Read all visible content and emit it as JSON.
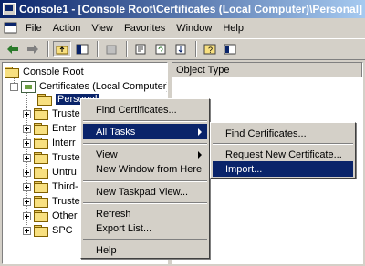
{
  "window": {
    "title": "Console1 - [Console Root\\Certificates (Local Computer)\\Personal]"
  },
  "menubar": {
    "items": [
      "File",
      "Action",
      "View",
      "Favorites",
      "Window",
      "Help"
    ]
  },
  "tree": {
    "root": "Console Root",
    "certificates": "Certificates (Local Computer)",
    "nodes": [
      "Personal",
      "Truste",
      "Enter",
      "Interr",
      "Truste",
      "Untru",
      "Third-",
      "Truste",
      "Other",
      "SPC"
    ]
  },
  "right_pane": {
    "column": "Object Type"
  },
  "context_menu": {
    "items": [
      "Find Certificates...",
      "All Tasks",
      "View",
      "New Window from Here",
      "New Taskpad View...",
      "Refresh",
      "Export List...",
      "Help"
    ]
  },
  "submenu": {
    "items": [
      "Find Certificates...",
      "Request New Certificate...",
      "Import..."
    ]
  },
  "colors": {
    "selection": "#0a246a",
    "face": "#d4d0c8"
  }
}
